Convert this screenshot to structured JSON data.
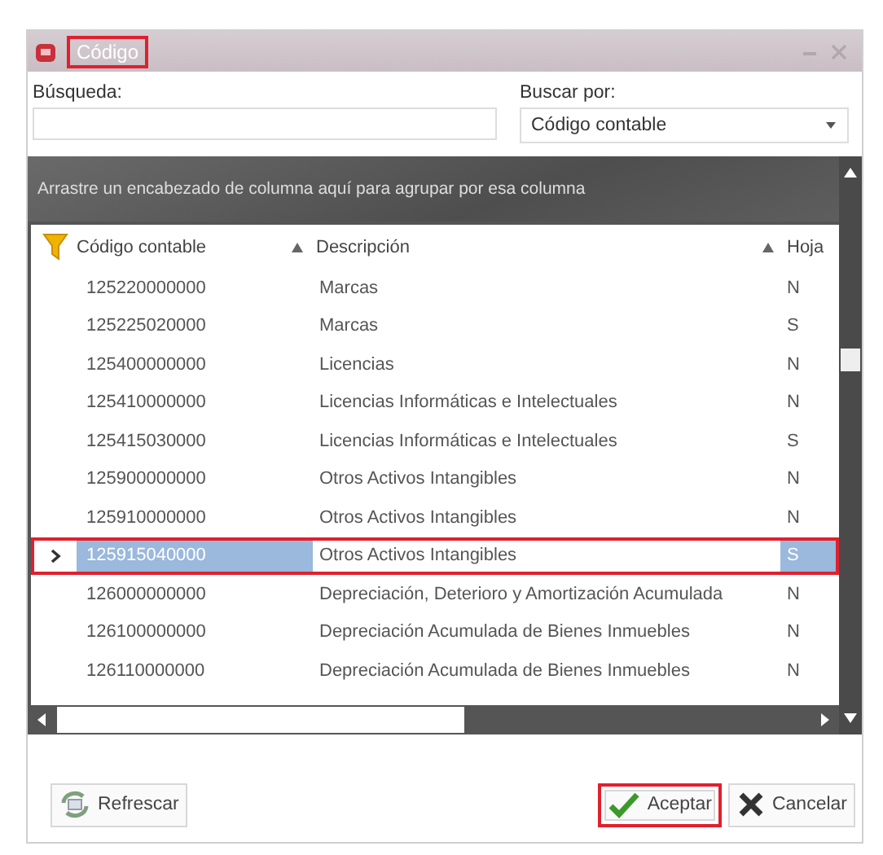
{
  "window": {
    "title": "Código",
    "title_highlighted": true
  },
  "search": {
    "label": "Búsqueda:"
  },
  "search_by": {
    "label": "Buscar por:",
    "value": "Código contable"
  },
  "group_panel": {
    "hint": "Arrastre un encabezado de columna aquí para agrupar por esa columna"
  },
  "table": {
    "columns": [
      {
        "label": "Código contable",
        "sorted": true
      },
      {
        "label": "Descripción",
        "sorted": true
      },
      {
        "label": "Hoja",
        "sorted": false
      }
    ],
    "rows": [
      {
        "cells": [
          "125220000000",
          "Marcas",
          "N"
        ],
        "selected": false,
        "highlighted": false
      },
      {
        "cells": [
          "125225020000",
          "Marcas",
          "S"
        ],
        "selected": false,
        "highlighted": false
      },
      {
        "cells": [
          "125400000000",
          "Licencias",
          "N"
        ],
        "selected": false,
        "highlighted": false
      },
      {
        "cells": [
          "125410000000",
          "Licencias Informáticas e Intelectuales",
          "N"
        ],
        "selected": false,
        "highlighted": false
      },
      {
        "cells": [
          "125415030000",
          "Licencias Informáticas e Intelectuales",
          "S"
        ],
        "selected": false,
        "highlighted": false
      },
      {
        "cells": [
          "125900000000",
          "Otros Activos Intangibles",
          "N"
        ],
        "selected": false,
        "highlighted": false
      },
      {
        "cells": [
          "125910000000",
          "Otros Activos Intangibles",
          "N"
        ],
        "selected": false,
        "highlighted": false
      },
      {
        "cells": [
          "125915040000",
          "Otros Activos Intangibles",
          "S"
        ],
        "selected": true,
        "highlighted": true
      },
      {
        "cells": [
          "126000000000",
          "Depreciación, Deterioro y Amortización Acumulada",
          "N"
        ],
        "selected": false,
        "highlighted": false
      },
      {
        "cells": [
          "126100000000",
          "Depreciación Acumulada de Bienes Inmuebles",
          "N"
        ],
        "selected": false,
        "highlighted": false
      },
      {
        "cells": [
          "126110000000",
          "Depreciación Acumulada de Bienes Inmuebles",
          "N"
        ],
        "selected": false,
        "highlighted": false
      }
    ]
  },
  "buttons": [
    {
      "label": "Refrescar",
      "kind": "refresh",
      "highlighted": false
    },
    {
      "label": "Aceptar",
      "kind": "accept",
      "highlighted": true
    },
    {
      "label": "Cancelar",
      "kind": "cancel",
      "highlighted": false
    }
  ]
}
